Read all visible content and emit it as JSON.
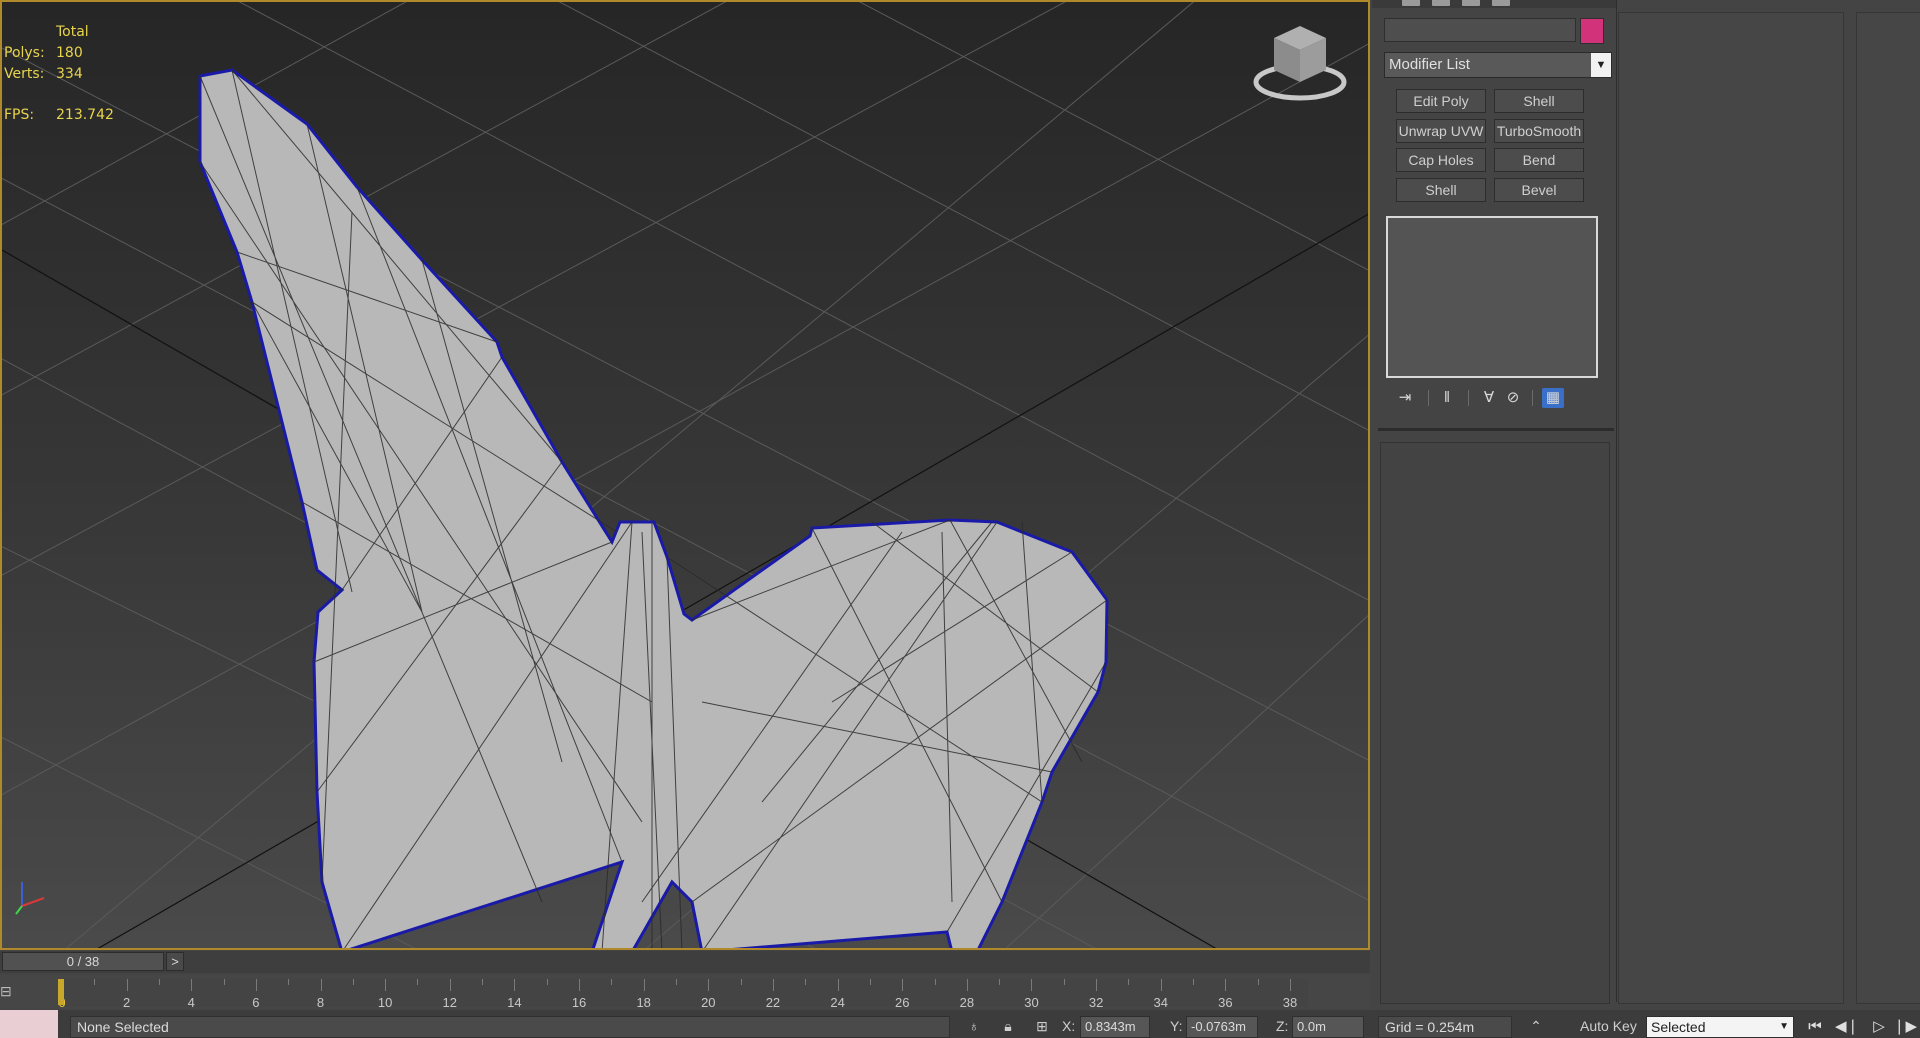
{
  "viewport": {
    "stats": {
      "total_label": "Total",
      "polys_label": "Polys:",
      "polys_value": "180",
      "verts_label": "Verts:",
      "verts_value": "334",
      "fps_label": "FPS:",
      "fps_value": "213.742"
    },
    "colors": {
      "stats_text": "#e8d44d",
      "active_border": "#b08a2a",
      "selection_outline": "#1a1aa8",
      "mesh_fill": "#b8b8b8"
    },
    "icons": [
      "viewcube-icon",
      "axis-tripod-icon"
    ]
  },
  "command_panel": {
    "object_name": "",
    "object_color": "#d2327a",
    "modifier_list_label": "Modifier List",
    "modifier_buttons": [
      "Edit Poly",
      "Shell",
      "Unwrap UVW",
      "TurboSmooth",
      "Cap Holes",
      "Bend",
      "Shell",
      "Bevel"
    ],
    "stack_tools": [
      "pin-stack-icon",
      "show-end-result-icon",
      "make-unique-icon",
      "remove-modifier-icon",
      "configure-modifier-sets-icon"
    ]
  },
  "time_slider": {
    "label": "0 / 38",
    "next_label": ">"
  },
  "track_bar": {
    "current_frame": "0",
    "tick_labels": [
      "0",
      "2",
      "4",
      "6",
      "8",
      "10",
      "12",
      "14",
      "16",
      "18",
      "20",
      "22",
      "24",
      "26",
      "28",
      "30",
      "32",
      "34",
      "36",
      "38"
    ],
    "frame_start": 0,
    "frame_end": 38
  },
  "status_bar": {
    "prompt_text": "None Selected",
    "x_label": "X:",
    "x_value": "0.8343m",
    "y_label": "Y:",
    "y_value": "-0.0763m",
    "z_label": "Z:",
    "z_value": "0.0m",
    "grid_text": "Grid = 0.254m",
    "auto_key_label": "Auto Key",
    "key_mode_selected": "Selected",
    "playback_icons": [
      "go-to-start-icon",
      "previous-frame-icon",
      "play-icon",
      "next-frame-icon"
    ]
  }
}
